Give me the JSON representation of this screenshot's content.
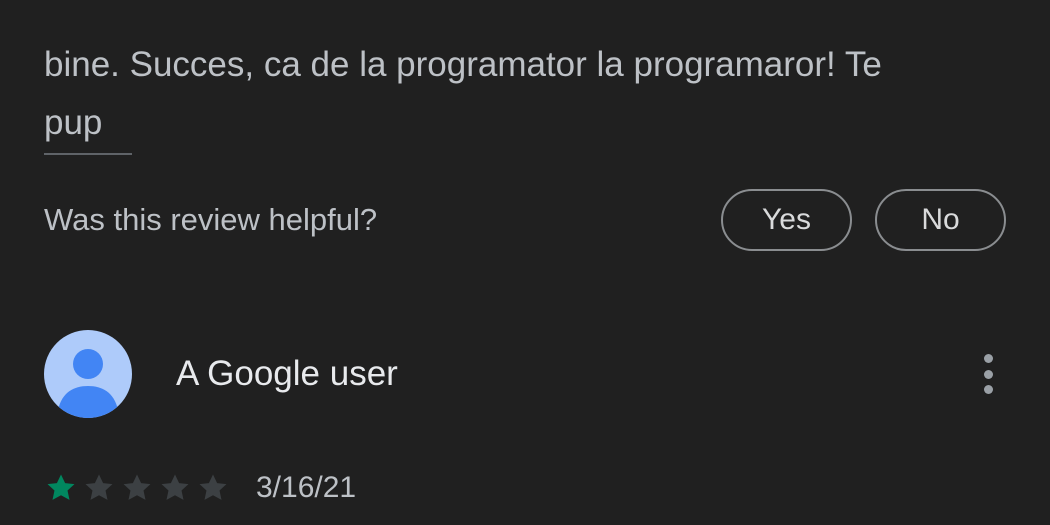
{
  "review": {
    "text_line_partial": "... ...",
    "text_line_1": "bine. Succes, ca de la programator la programaror! Te",
    "text_line_2": "pup"
  },
  "helpful": {
    "question": "Was this review helpful?",
    "yes_label": "Yes",
    "no_label": "No"
  },
  "next_review": {
    "author": "A Google user",
    "rating": 1,
    "rating_max": 5,
    "date": "3/16/21"
  },
  "colors": {
    "background": "#202020",
    "star_filled": "#01875f",
    "star_empty": "#3c4043",
    "avatar_bg": "#aecbfa",
    "avatar_figure": "#4285f4"
  },
  "icons": {
    "avatar": "person-icon",
    "menu": "more-vert-icon",
    "star": "star-icon"
  }
}
